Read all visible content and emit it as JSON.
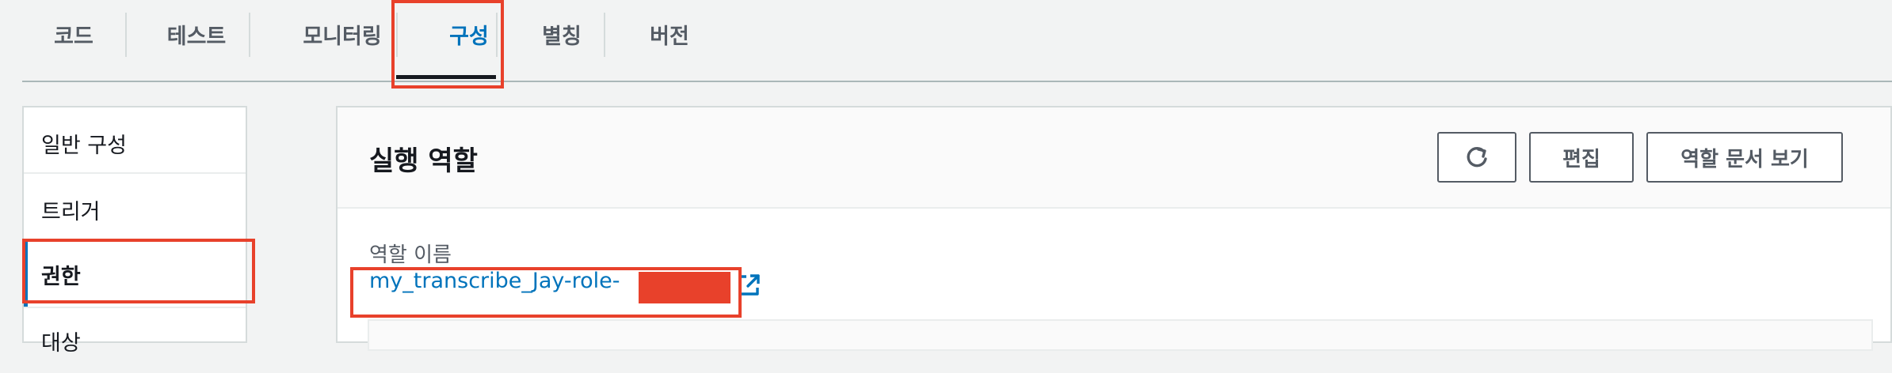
{
  "tabs": [
    {
      "label": "코드",
      "active": false
    },
    {
      "label": "테스트",
      "active": false
    },
    {
      "label": "모니터링",
      "active": false
    },
    {
      "label": "구성",
      "active": true
    },
    {
      "label": "별칭",
      "active": false
    },
    {
      "label": "버전",
      "active": false
    }
  ],
  "sidebar": {
    "items": [
      {
        "label": "일반 구성",
        "active": false
      },
      {
        "label": "트리거",
        "active": false
      },
      {
        "label": "권한",
        "active": true
      },
      {
        "label": "대상",
        "active": false
      }
    ]
  },
  "panel": {
    "title": "실행 역할",
    "refresh_icon": "refresh-icon",
    "edit_label": "편집",
    "view_doc_label": "역할 문서 보기",
    "role_name_label": "역할 이름",
    "role_name_value": "my_transcribe_Jay-role-",
    "external_link_icon": "external-link-icon"
  },
  "colors": {
    "accent": "#0073bb",
    "highlight": "#e8412b",
    "text": "#16191f",
    "muted": "#545b64"
  }
}
